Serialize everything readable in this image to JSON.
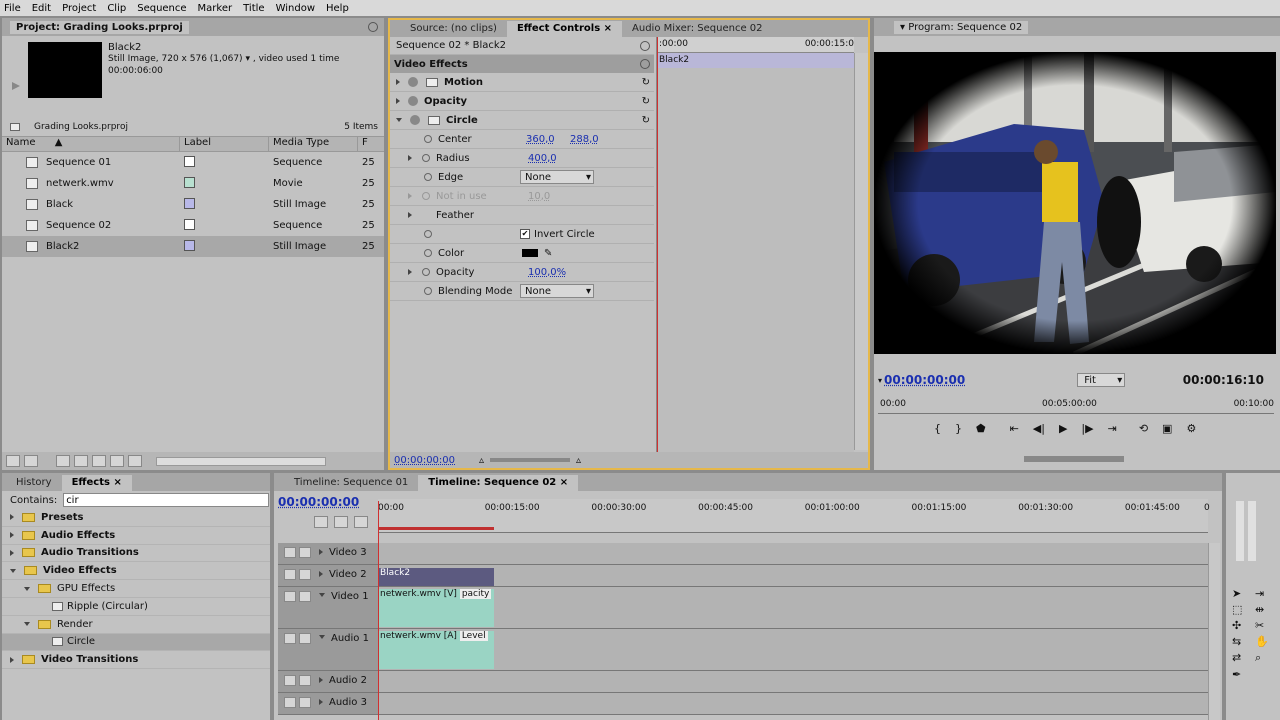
{
  "menu": [
    "File",
    "Edit",
    "Project",
    "Clip",
    "Sequence",
    "Marker",
    "Title",
    "Window",
    "Help"
  ],
  "project": {
    "title": "Project: Grading Looks.prproj",
    "clip_name": "Black2",
    "clip_info1": "Still Image, 720 x 576 (1,067)",
    "clip_info2": ", video used 1 time",
    "clip_duration": "00:00:06:00",
    "bin_name": "Grading Looks.prproj",
    "item_count": "5 Items",
    "col_name": "Name",
    "col_label": "Label",
    "col_type": "Media Type",
    "col_f": "F",
    "items": [
      {
        "name": "Sequence 01",
        "label_color": "#ffffff",
        "type": "Sequence",
        "f": "25"
      },
      {
        "name": "netwerk.wmv",
        "label_color": "#b8e0d0",
        "type": "Movie",
        "f": "25"
      },
      {
        "name": "Black",
        "label_color": "#b8b8e8",
        "type": "Still Image",
        "f": "25"
      },
      {
        "name": "Sequence 02",
        "label_color": "#ffffff",
        "type": "Sequence",
        "f": "25"
      },
      {
        "name": "Black2",
        "label_color": "#b8b8e8",
        "type": "Still Image",
        "f": "25"
      }
    ]
  },
  "ec": {
    "tabs": [
      "Source: (no clips)",
      "Effect Controls",
      "Audio Mixer: Sequence 02"
    ],
    "seq_label": "Sequence 02 * Black2",
    "section": "Video Effects",
    "effects": [
      "Motion",
      "Opacity",
      "Circle"
    ],
    "params": {
      "center": "Center",
      "center_x": "360,0",
      "center_y": "288,0",
      "radius": "Radius",
      "radius_v": "400,0",
      "edge": "Edge",
      "edge_v": "None",
      "notinuse": "Not in use",
      "notinuse_v": "10,0",
      "feather": "Feather",
      "invert": "Invert Circle",
      "color": "Color",
      "opacity": "Opacity",
      "opacity_v": "100,0%",
      "blend": "Blending Mode",
      "blend_v": "None"
    },
    "tl_start": ":00:00",
    "tl_end": "00:00:15:0",
    "tl_clip": "Black2",
    "time": "00:00:00:00"
  },
  "program": {
    "title": "Program: Sequence 02",
    "time": "00:00:00:00",
    "fit": "Fit",
    "duration": "00:00:16:10",
    "ruler": [
      "00:00",
      "00:05:00:00",
      "00:10:00"
    ]
  },
  "effects_panel": {
    "tabs": [
      "History",
      "Effects"
    ],
    "contains_label": "Contains:",
    "search": "cir",
    "tree": [
      {
        "label": "Presets",
        "level": 0,
        "open": false,
        "bold": true
      },
      {
        "label": "Audio Effects",
        "level": 0,
        "open": false,
        "bold": true
      },
      {
        "label": "Audio Transitions",
        "level": 0,
        "open": false,
        "bold": true
      },
      {
        "label": "Video Effects",
        "level": 0,
        "open": true,
        "bold": true
      },
      {
        "label": "GPU Effects",
        "level": 1,
        "open": true,
        "bold": false
      },
      {
        "label": "Ripple (Circular)",
        "level": 2,
        "open": false,
        "bold": false
      },
      {
        "label": "Render",
        "level": 1,
        "open": true,
        "bold": false
      },
      {
        "label": "Circle",
        "level": 2,
        "open": false,
        "bold": false
      },
      {
        "label": "Video Transitions",
        "level": 0,
        "open": false,
        "bold": true
      }
    ]
  },
  "timeline": {
    "tabs": [
      "Timeline: Sequence 01",
      "Timeline: Sequence 02"
    ],
    "time": "00:00:00:00",
    "ruler": [
      "00:00",
      "00:00:15:00",
      "00:00:30:00",
      "00:00:45:00",
      "00:01:00:00",
      "00:01:15:00",
      "00:01:30:00",
      "00:01:45:00",
      "0"
    ],
    "tracks": [
      "Video 3",
      "Video 2",
      "Video 1",
      "Audio 1",
      "Audio 2",
      "Audio 3"
    ],
    "clip_v2": "Black2",
    "clip_v1": "netwerk.wmv [V]",
    "clip_v1_fx": "pacity",
    "clip_a1": "netwerk.wmv [A]",
    "clip_a1_fx": "Level"
  }
}
